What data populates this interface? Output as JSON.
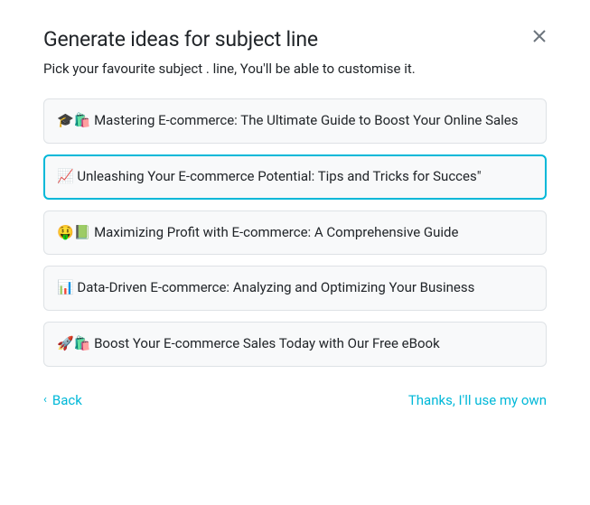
{
  "header": {
    "title": "Generate ideas for subject line",
    "subtitle": "Pick your favourite subject . line, You'll be able to customise it."
  },
  "options": [
    {
      "text": "🎓🛍️ Mastering E-commerce: The Ultimate Guide to Boost Your Online Sales",
      "selected": false
    },
    {
      "text": "📈 Unleashing Your E-commerce Potential: Tips and Tricks for Succes\"",
      "selected": true
    },
    {
      "text": "🤑📗 Maximizing Profit with E-commerce: A Comprehensive Guide",
      "selected": false
    },
    {
      "text": "📊 Data-Driven E-commerce: Analyzing and Optimizing Your Business",
      "selected": false
    },
    {
      "text": "🚀🛍️ Boost Your E-commerce Sales Today with Our Free eBook",
      "selected": false
    }
  ],
  "footer": {
    "back_label": "Back",
    "skip_label": "Thanks, I'll use my own"
  }
}
